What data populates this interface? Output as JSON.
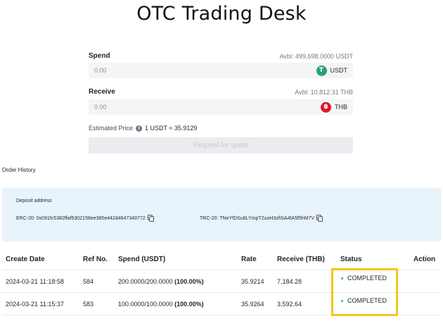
{
  "page": {
    "title": "OTC Trading Desk"
  },
  "spend": {
    "label": "Spend",
    "available": "Avbl: 499,698.0000 USDT",
    "placeholder": "0.00",
    "coin": "USDT",
    "coin_symbol": "T",
    "coin_color": "#26a17b"
  },
  "receive": {
    "label": "Receive",
    "available": "Avbl: 10,812.31 THB",
    "placeholder": "0.00",
    "coin": "THB",
    "coin_symbol": "฿",
    "coin_color": "#e0162b"
  },
  "estimate": {
    "label": "Estimated Price",
    "value": "1 USDT ≈ 35.9129"
  },
  "request_button": "Request for quote",
  "order_history": "Order History",
  "deposit": {
    "title": "Deposit address",
    "erc20": "ERC-20: 0x091fc5382ffaf5302158ee385e442d4647349772",
    "trc20": "TRC-20: TNeYfDSu8LYmpT2uoH3zfiSA4fA5f5hM7V"
  },
  "table": {
    "headers": [
      "Create Date",
      "Ref No.",
      "Spend (USDT)",
      "Rate",
      "Receive (THB)",
      "Status",
      "Action"
    ],
    "rows": [
      {
        "date": "2024-03-21 11:18:58",
        "ref": "584",
        "spend": "200.0000/200.0000",
        "pct": "(100.00%)",
        "rate": "35.9214",
        "receive": "7,184.28",
        "status": "COMPLETED"
      },
      {
        "date": "2024-03-21 11:15:37",
        "ref": "583",
        "spend": "100.0000/100.0000",
        "pct": "(100.00%)",
        "rate": "35.9264",
        "receive": "3,592.64",
        "status": "COMPLETED"
      }
    ]
  },
  "colors": {
    "status_dot": "#0ecb81",
    "highlight": "#f5c518",
    "deposit_bg": "#e9f3fb"
  }
}
